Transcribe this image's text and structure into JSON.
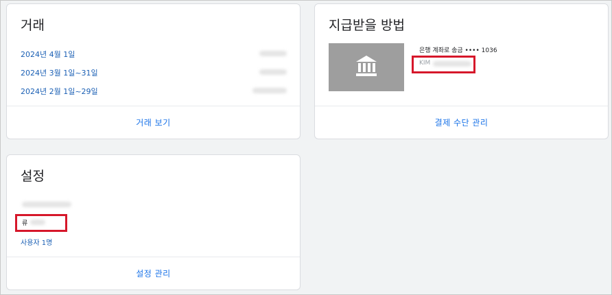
{
  "transactions": {
    "title": "거래",
    "rows": [
      {
        "date": "2024년 4월 1일"
      },
      {
        "date": "2024년 3월 1일~31일"
      },
      {
        "date": "2024년 2월 1일~29일"
      }
    ],
    "footer": "거래 보기"
  },
  "payout": {
    "title": "지급받을 방법",
    "method": "은행 계좌로 송금 •••• 1036",
    "holder_prefix": "KIM",
    "footer": "결제 수단 관리"
  },
  "settings": {
    "title": "설정",
    "name_prefix": "류",
    "users": "사용자 1명",
    "footer": "설정 관리"
  },
  "colors": {
    "link": "#1a5fb4",
    "highlight": "#d6172a",
    "bank_tile": "#9e9e9e"
  },
  "icons": {
    "bank": "bank-icon"
  }
}
